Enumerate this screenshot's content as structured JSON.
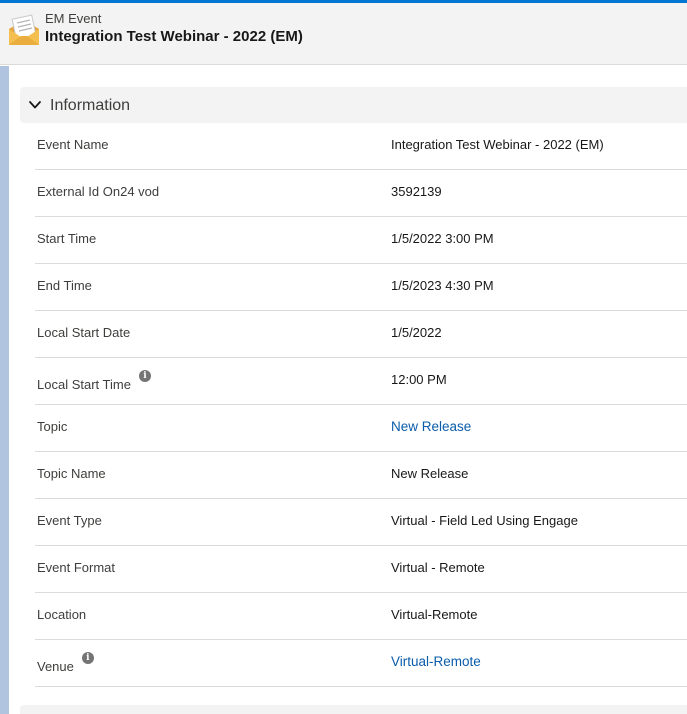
{
  "header": {
    "object_type": "EM Event",
    "record_title": "Integration Test Webinar - 2022 (EM)",
    "icon": "envelope-icon"
  },
  "section": {
    "title": "Information",
    "icon": "chevron-down-icon"
  },
  "fields": [
    {
      "label": "Event Name",
      "value": "Integration Test Webinar - 2022 (EM)",
      "link": false,
      "info": false
    },
    {
      "label": "External Id On24 vod",
      "value": "3592139",
      "link": false,
      "info": false
    },
    {
      "label": "Start Time",
      "value": "1/5/2022 3:00 PM",
      "link": false,
      "info": false
    },
    {
      "label": "End Time",
      "value": "1/5/2023 4:30 PM",
      "link": false,
      "info": false
    },
    {
      "label": "Local Start Date",
      "value": "1/5/2022",
      "link": false,
      "info": false
    },
    {
      "label": "Local Start Time",
      "value": "12:00 PM",
      "link": false,
      "info": true
    },
    {
      "label": "Topic",
      "value": "New Release",
      "link": true,
      "info": false
    },
    {
      "label": "Topic Name",
      "value": "New Release",
      "link": false,
      "info": false
    },
    {
      "label": "Event Type",
      "value": "Virtual - Field Led Using Engage",
      "link": false,
      "info": false
    },
    {
      "label": "Event Format",
      "value": "Virtual - Remote",
      "link": false,
      "info": false
    },
    {
      "label": "Location",
      "value": "Virtual-Remote",
      "link": false,
      "info": false
    },
    {
      "label": "Venue",
      "value": "Virtual-Remote",
      "link": true,
      "info": true
    }
  ],
  "colors": {
    "accent": "#0176d3",
    "link": "#0b5cab",
    "header_bg": "#f3f3f3",
    "rail": "#b0c4df"
  }
}
